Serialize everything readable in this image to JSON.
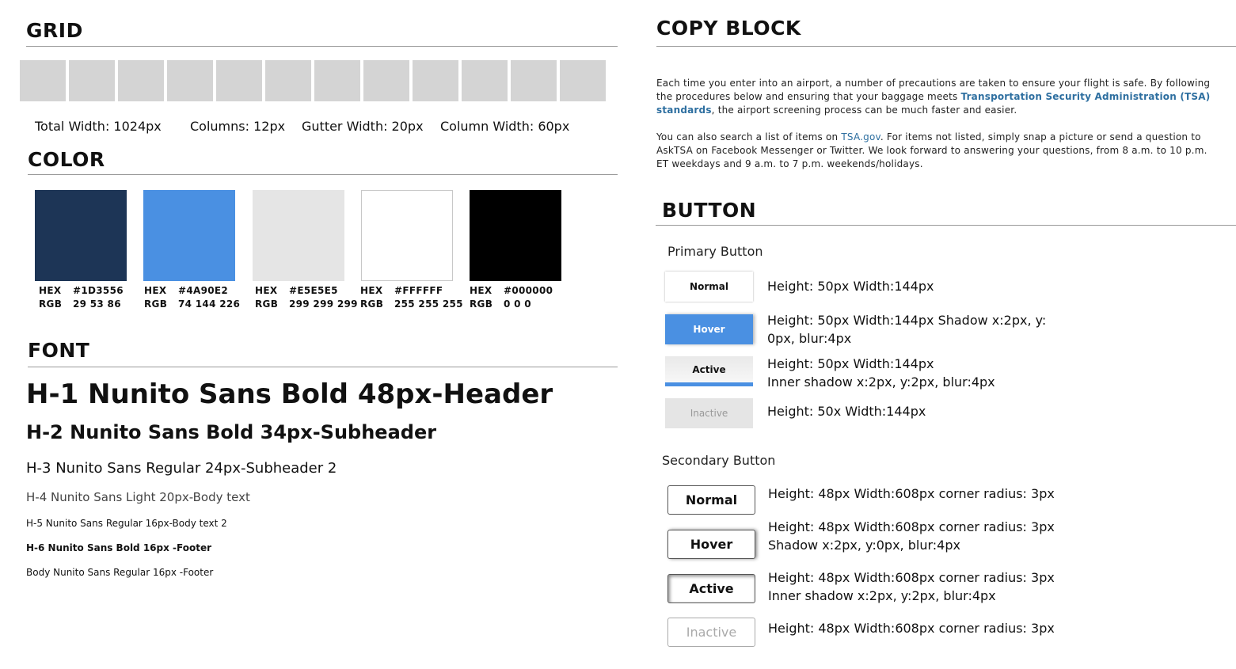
{
  "grid": {
    "title": "GRID",
    "column_count": 12,
    "column_color": "#D4D4D4",
    "total_width": "Total Width: 1024px",
    "columns": "Columns: 12px",
    "gutter_width": "Gutter Width: 20px",
    "column_width": "Column Width: 60px"
  },
  "color": {
    "title": "COLOR",
    "hex_label": "HEX",
    "rgb_label": "RGB",
    "swatches": [
      {
        "hex": "#1D3556",
        "rgb": "29 53 86"
      },
      {
        "hex": "#4A90E2",
        "rgb": "74 144 226"
      },
      {
        "hex": "#E5E5E5",
        "rgb": "299 299 299"
      },
      {
        "hex": "#FFFFFF",
        "rgb": "255 255 255"
      },
      {
        "hex": "#000000",
        "rgb": "0 0 0"
      }
    ]
  },
  "font": {
    "title": "FONT",
    "h1": "H-1 Nunito Sans Bold 48px-Header",
    "h2": "H-2 Nunito Sans Bold 34px-Subheader",
    "h3": "H-3 Nunito Sans Regular 24px-Subheader 2",
    "h4": "H-4 Nunito Sans Light 20px-Body text",
    "h5": "H-5 Nunito Sans Regular 16px-Body text 2",
    "h6": "H-6 Nunito Sans Bold 16px -Footer",
    "body": "Body Nunito Sans Regular 16px -Footer"
  },
  "copy_block": {
    "title": "COPY BLOCK",
    "p1_before": "Each time you enter into an airport, a number of precautions are taken to ensure your flight is safe. By following the procedures below and ensuring that your baggage meets ",
    "p1_link": "Transportation Security Administration (TSA) standards",
    "p1_after": ", the airport screening process can be much faster and easier.",
    "p2_before": "You can also search a list of items on ",
    "p2_link": "TSA.gov",
    "p2_after": ".  For items not listed, simply snap a picture or send a question to AskTSA on Facebook Messenger or Twitter. We look forward to answering your questions, from 8 a.m. to 10 p.m. ET weekdays and 9 a.m. to 7 p.m. weekends/holidays."
  },
  "button": {
    "title": "BUTTON",
    "primary_label": "Primary Button",
    "secondary_label": "Secondary Button",
    "primary": {
      "normal": {
        "label": "Normal",
        "desc1": "Height: 50px Width:144px",
        "desc2": ""
      },
      "hover": {
        "label": "Hover",
        "desc1": "Height: 50px Width:144px Shadow x:2px, y:",
        "desc2": "0px, blur:4px"
      },
      "active": {
        "label": "Active",
        "desc1": "Height: 50px Width:144px",
        "desc2": "Inner shadow x:2px, y:2px, blur:4px"
      },
      "inactive": {
        "label": "Inactive",
        "desc1": "Height: 50x Width:144px",
        "desc2": ""
      }
    },
    "secondary": {
      "normal": {
        "label": "Normal",
        "desc1": "Height: 48px Width:608px  corner radius: 3px",
        "desc2": ""
      },
      "hover": {
        "label": "Hover",
        "desc1": "Height: 48px Width:608px  corner radius: 3px",
        "desc2": "Shadow x:2px, y:0px, blur:4px"
      },
      "active": {
        "label": "Active",
        "desc1": "Height: 48px Width:608px  corner radius: 3px",
        "desc2": "Inner shadow x:2px, y:2px, blur:4px"
      },
      "inactive": {
        "label": "Inactive",
        "desc1": "Height: 48px Width:608px  corner radius: 3px",
        "desc2": ""
      }
    }
  }
}
